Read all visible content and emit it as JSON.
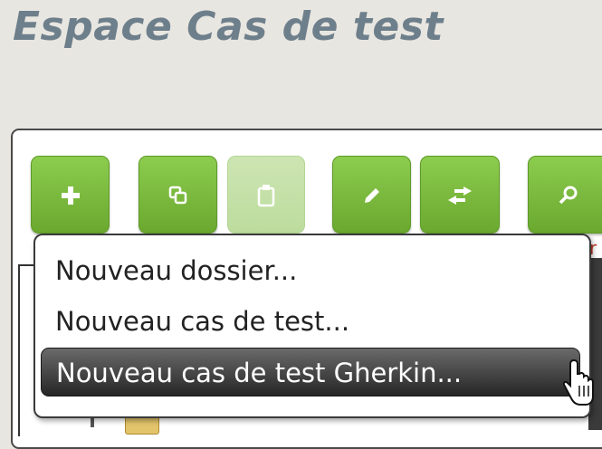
{
  "page": {
    "title": "Espace Cas de test"
  },
  "toolbar": {
    "buttons": [
      {
        "icon": "plus-icon",
        "state": "enabled"
      },
      {
        "icon": "copy-icon",
        "state": "enabled"
      },
      {
        "icon": "paste-icon",
        "state": "disabled"
      },
      {
        "icon": "pencil-icon",
        "state": "enabled"
      },
      {
        "icon": "move-arrows-icon",
        "state": "enabled"
      },
      {
        "icon": "search-icon",
        "state": "enabled"
      }
    ]
  },
  "menu": {
    "items": [
      {
        "label": "Nouveau dossier..."
      },
      {
        "label": "Nouveau cas de test..."
      },
      {
        "label": "Nouveau cas de test Gherkin...",
        "highlighted": true
      }
    ]
  },
  "background": {
    "partial_text": "r"
  },
  "colors": {
    "title": "#6e7f8c",
    "button_green": "#7aba3e",
    "button_disabled": "#c6e1a8",
    "menu_highlight": "#3c3c3c",
    "background": "#e8e6e0"
  }
}
